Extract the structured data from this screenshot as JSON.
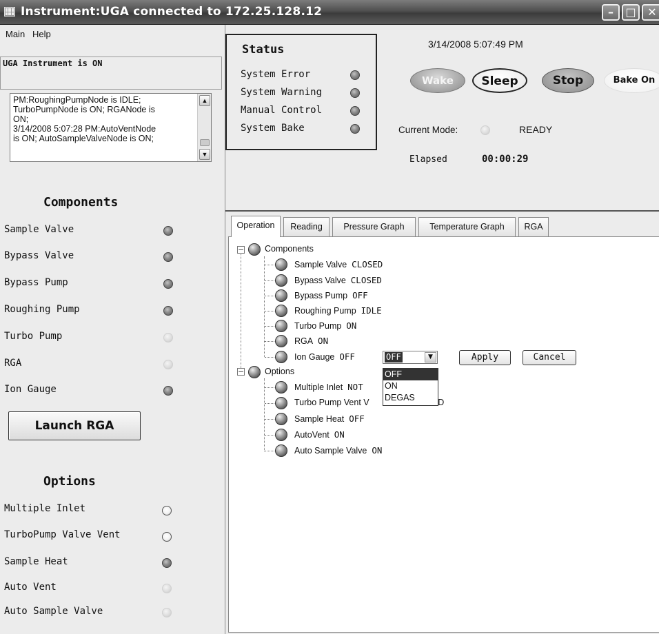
{
  "window": {
    "title": "Instrument:UGA connected to 172.25.128.12"
  },
  "menu": {
    "items": [
      "Main",
      "Help"
    ]
  },
  "instrument_status": "UGA Instrument is ON",
  "log_lines": [
    "PM:RoughingPumpNode is IDLE;",
    "TurboPumpNode is ON; RGANode is",
    "ON;",
    "3/14/2008 5:07:28 PM:AutoVentNode",
    "is ON; AutoSampleValveNode is ON;"
  ],
  "components": {
    "title": "Components",
    "items": [
      {
        "label": "Sample Valve",
        "state": "dark"
      },
      {
        "label": "Bypass Valve",
        "state": "dark"
      },
      {
        "label": "Bypass Pump",
        "state": "dark"
      },
      {
        "label": "Roughing Pump",
        "state": "dark"
      },
      {
        "label": "Turbo Pump",
        "state": "light"
      },
      {
        "label": "RGA",
        "state": "light"
      },
      {
        "label": "Ion Gauge",
        "state": "dark"
      }
    ],
    "launch_label": "Launch RGA"
  },
  "options": {
    "title": "Options",
    "items": [
      {
        "label": "Multiple Inlet",
        "state": "hollow"
      },
      {
        "label": "TurboPump Valve Vent",
        "state": "hollow"
      },
      {
        "label": "Sample Heat",
        "state": "dark"
      },
      {
        "label": "Auto Vent",
        "state": "light"
      },
      {
        "label": "Auto Sample Valve",
        "state": "light"
      }
    ]
  },
  "status": {
    "title": "Status",
    "rows": [
      {
        "label": "System Error"
      },
      {
        "label": "System Warning"
      },
      {
        "label": "Manual Control"
      },
      {
        "label": "System Bake"
      }
    ]
  },
  "datetime": "3/14/2008 5:07:49 PM",
  "controls": {
    "wake": "Wake",
    "sleep": "Sleep",
    "stop": "Stop",
    "bake": "Bake On"
  },
  "mode": {
    "label": "Current Mode:",
    "value": "READY"
  },
  "elapsed": {
    "label": "Elapsed",
    "value": "00:00:29"
  },
  "tabs": [
    "Operation",
    "Reading",
    "Pressure Graph",
    "Temperature Graph",
    "RGA"
  ],
  "tree": {
    "components_label": "Components",
    "components": [
      {
        "name": "Sample Valve",
        "value": "CLOSED"
      },
      {
        "name": "Bypass Valve",
        "value": "CLOSED"
      },
      {
        "name": "Bypass Pump",
        "value": "OFF"
      },
      {
        "name": "Roughing Pump",
        "value": "IDLE"
      },
      {
        "name": "Turbo Pump",
        "value": "ON"
      },
      {
        "name": "RGA",
        "value": "ON"
      },
      {
        "name": "Ion Gauge",
        "value": "OFF"
      }
    ],
    "options_label": "Options",
    "options": [
      {
        "name": "Multiple Inlet",
        "value": "NOT"
      },
      {
        "name": "Turbo Pump Vent V",
        "value": "STALLED"
      },
      {
        "name": "Sample Heat",
        "value": "OFF"
      },
      {
        "name": "AutoVent",
        "value": "ON"
      },
      {
        "name": "Auto Sample Valve",
        "value": "ON"
      }
    ]
  },
  "ion_gauge_select": {
    "selected": "OFF",
    "options": [
      "OFF",
      "ON",
      "DEGAS"
    ],
    "apply_label": "Apply",
    "cancel_label": "Cancel"
  }
}
